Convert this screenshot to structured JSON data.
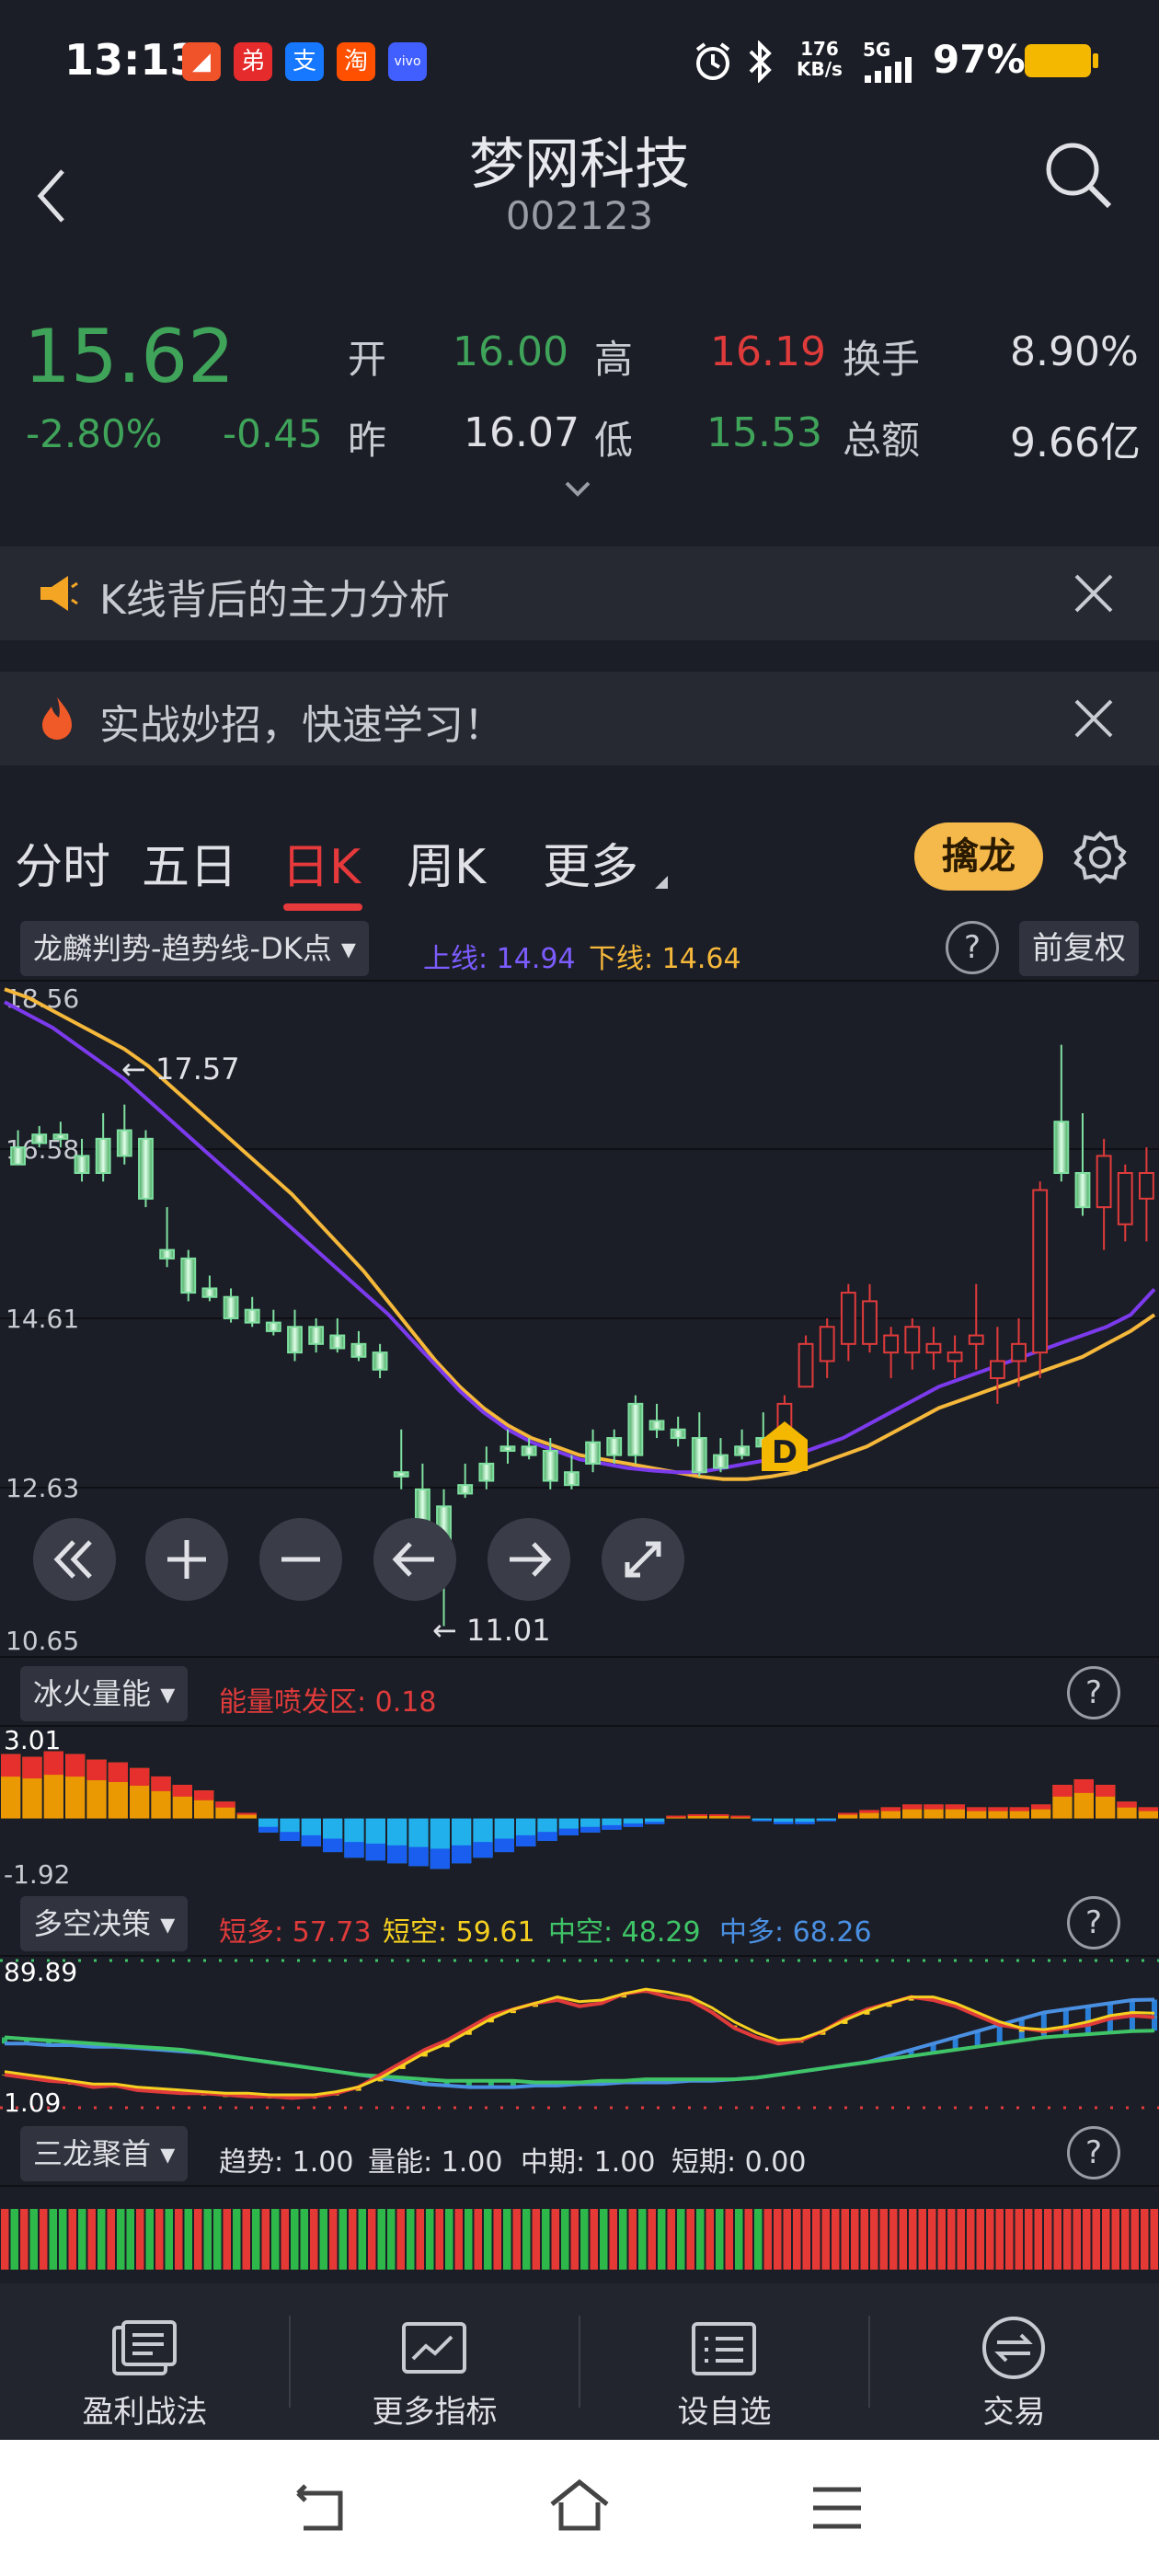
{
  "status_bar": {
    "time": "13:13",
    "net_speed_value": "176",
    "net_speed_unit": "KB/s",
    "network": "5G",
    "battery": "97%",
    "apps": [
      {
        "glyph": "◢",
        "color": "#f0522a"
      },
      {
        "glyph": "弟",
        "color": "#e52b2b"
      },
      {
        "glyph": "支",
        "color": "#1677ff"
      },
      {
        "glyph": "淘",
        "color": "#ff5000"
      },
      {
        "glyph": "vivo",
        "color": "#415fff"
      }
    ]
  },
  "header": {
    "name": "梦网科技",
    "code": "002123"
  },
  "quote": {
    "price": "15.62",
    "change_pct": "-2.80%",
    "change": "-0.45",
    "open_label": "开",
    "open": "16.00",
    "high_label": "高",
    "high": "16.19",
    "turnover_label": "换手",
    "turnover": "8.90%",
    "prev_label": "昨",
    "prev": "16.07",
    "low_label": "低",
    "low": "15.53",
    "amount_label": "总额",
    "amount": "9.66亿"
  },
  "banners": [
    {
      "text": "K线背后的主力分析"
    },
    {
      "text": "实战妙招，快速学习！"
    }
  ],
  "tabs": [
    {
      "label": "分时"
    },
    {
      "label": "五日"
    },
    {
      "label": "日K"
    },
    {
      "label": "周K"
    },
    {
      "label": "更多"
    }
  ],
  "tab_active": "日K",
  "qinlong_button": "擒龙",
  "main_chart": {
    "indicator": "龙麟判势-趋势线-DK点",
    "upper_label": "上线: 14.94",
    "lower_label": "下线: 14.64",
    "adjust": "前复权",
    "axis": [
      "18.56",
      "16.58",
      "14.61",
      "12.63",
      "10.65"
    ],
    "max_label": "17.57",
    "min_label": "11.01",
    "dk_marker": "D"
  },
  "colors": {
    "up": "#e03b3b",
    "down": "#3fa45a",
    "upper_line": "#7c3aed",
    "lower_line": "#f5b83a"
  },
  "chart_data": [
    {
      "type": "candlestick",
      "title": "",
      "ylim": [
        10.65,
        18.56
      ],
      "candles": [
        [
          16.6,
          16.8,
          16.4,
          16.4
        ],
        [
          16.75,
          16.85,
          16.6,
          16.65
        ],
        [
          16.75,
          16.9,
          16.6,
          16.7
        ],
        [
          16.5,
          16.7,
          16.2,
          16.3
        ],
        [
          16.7,
          17.0,
          16.2,
          16.3
        ],
        [
          16.8,
          17.1,
          16.4,
          16.5
        ],
        [
          16.7,
          16.8,
          15.9,
          16.0
        ],
        [
          15.4,
          15.9,
          15.2,
          15.3
        ],
        [
          15.3,
          15.4,
          14.8,
          14.9
        ],
        [
          14.95,
          15.1,
          14.8,
          14.85
        ],
        [
          14.85,
          14.95,
          14.55,
          14.6
        ],
        [
          14.7,
          14.85,
          14.5,
          14.55
        ],
        [
          14.55,
          14.7,
          14.4,
          14.45
        ],
        [
          14.5,
          14.7,
          14.1,
          14.2
        ],
        [
          14.5,
          14.6,
          14.2,
          14.3
        ],
        [
          14.4,
          14.6,
          14.2,
          14.25
        ],
        [
          14.3,
          14.45,
          14.1,
          14.15
        ],
        [
          14.2,
          14.3,
          13.9,
          14.0
        ],
        [
          12.8,
          13.3,
          12.6,
          12.75
        ],
        [
          12.6,
          12.9,
          11.8,
          12.2
        ],
        [
          12.4,
          12.6,
          11.0,
          11.6
        ],
        [
          12.65,
          12.9,
          12.5,
          12.55
        ],
        [
          12.9,
          13.1,
          12.6,
          12.7
        ],
        [
          13.1,
          13.3,
          12.9,
          13.05
        ],
        [
          13.1,
          13.2,
          12.95,
          13.0
        ],
        [
          13.05,
          13.2,
          12.6,
          12.7
        ],
        [
          12.8,
          13.0,
          12.6,
          12.65
        ],
        [
          13.15,
          13.3,
          12.8,
          12.9
        ],
        [
          13.2,
          13.3,
          12.9,
          13.0
        ],
        [
          13.6,
          13.7,
          12.9,
          13.0
        ],
        [
          13.4,
          13.6,
          13.2,
          13.3
        ],
        [
          13.3,
          13.45,
          13.1,
          13.2
        ],
        [
          13.2,
          13.5,
          12.75,
          12.8
        ],
        [
          13.0,
          13.2,
          12.8,
          12.85
        ],
        [
          13.1,
          13.3,
          12.95,
          13.0
        ],
        [
          13.2,
          13.5,
          12.9,
          13.1
        ],
        [
          13.3,
          13.7,
          13.2,
          13.6
        ],
        [
          13.8,
          14.4,
          13.8,
          14.3
        ],
        [
          14.1,
          14.6,
          13.9,
          14.5
        ],
        [
          14.3,
          15.0,
          14.1,
          14.9
        ],
        [
          14.3,
          15.0,
          14.2,
          14.8
        ],
        [
          14.2,
          14.5,
          13.9,
          14.4
        ],
        [
          14.2,
          14.6,
          14.0,
          14.5
        ],
        [
          14.2,
          14.5,
          14.0,
          14.3
        ],
        [
          14.1,
          14.4,
          13.9,
          14.2
        ],
        [
          14.3,
          15.0,
          14.0,
          14.4
        ],
        [
          13.9,
          14.5,
          13.6,
          14.1
        ],
        [
          14.1,
          14.6,
          13.8,
          14.3
        ],
        [
          14.2,
          16.2,
          13.9,
          16.1
        ],
        [
          16.9,
          17.8,
          16.2,
          16.3
        ],
        [
          16.3,
          17.0,
          15.8,
          15.9
        ],
        [
          15.9,
          16.7,
          15.4,
          16.5
        ],
        [
          15.7,
          16.4,
          15.5,
          16.3
        ],
        [
          16.0,
          16.6,
          15.5,
          16.3
        ]
      ],
      "upper_line": [
        18.3,
        18.15,
        18.0,
        17.8,
        17.6,
        17.4,
        17.15,
        16.9,
        16.65,
        16.4,
        16.15,
        15.9,
        15.65,
        15.4,
        15.15,
        14.9,
        14.65,
        14.35,
        14.05,
        13.75,
        13.5,
        13.3,
        13.15,
        13.05,
        12.95,
        12.9,
        12.85,
        12.82,
        12.8,
        12.8,
        12.85,
        12.9,
        12.95,
        13.0,
        13.1,
        13.2,
        13.35,
        13.5,
        13.65,
        13.8,
        13.9,
        14.0,
        14.1,
        14.2,
        14.3,
        14.4,
        14.5,
        14.64,
        14.94
      ],
      "lower_line": [
        18.45,
        18.35,
        18.2,
        18.05,
        17.9,
        17.75,
        17.55,
        17.3,
        17.05,
        16.8,
        16.55,
        16.3,
        16.05,
        15.75,
        15.45,
        15.15,
        14.8,
        14.45,
        14.1,
        13.8,
        13.55,
        13.35,
        13.2,
        13.1,
        13.0,
        12.95,
        12.9,
        12.85,
        12.8,
        12.75,
        12.72,
        12.72,
        12.75,
        12.8,
        12.9,
        13.0,
        13.1,
        13.25,
        13.4,
        13.55,
        13.65,
        13.75,
        13.85,
        13.95,
        14.05,
        14.15,
        14.3,
        14.45,
        14.64
      ]
    },
    {
      "type": "bar",
      "title": "冰火量能",
      "ylim": [
        -1.92,
        3.01
      ],
      "values": [
        2.3,
        2.2,
        2.4,
        2.3,
        2.1,
        2.0,
        1.8,
        1.5,
        1.2,
        1.0,
        0.6,
        0.2,
        -0.5,
        -0.8,
        -1.0,
        -1.2,
        -1.4,
        -1.5,
        -1.6,
        -1.7,
        -1.8,
        -1.6,
        -1.4,
        -1.2,
        -1.0,
        -0.8,
        -0.6,
        -0.5,
        -0.4,
        -0.3,
        -0.2,
        0.1,
        0.15,
        0.15,
        0.1,
        -0.1,
        -0.2,
        -0.2,
        -0.1,
        0.2,
        0.3,
        0.4,
        0.5,
        0.5,
        0.5,
        0.4,
        0.4,
        0.4,
        0.5,
        1.2,
        1.4,
        1.2,
        0.6,
        0.4
      ]
    },
    {
      "type": "line",
      "title": "多空决策",
      "ylim": [
        1.09,
        89.89
      ],
      "series": [
        {
          "name": "短多",
          "values": [
            20,
            18,
            16,
            15,
            12,
            13,
            10,
            9,
            8,
            8,
            7,
            6,
            6,
            5,
            6,
            8,
            12,
            20,
            28,
            36,
            42,
            50,
            58,
            62,
            66,
            68,
            64,
            66,
            72,
            74,
            70,
            68,
            60,
            50,
            44,
            40,
            42,
            48,
            56,
            62,
            66,
            70,
            68,
            64,
            58,
            52,
            50,
            48,
            50,
            52,
            56,
            58,
            57
          ]
        },
        {
          "name": "短空",
          "values": [
            22,
            20,
            18,
            16,
            14,
            14,
            12,
            11,
            10,
            9,
            8,
            8,
            7,
            7,
            7,
            9,
            12,
            18,
            26,
            34,
            40,
            48,
            56,
            62,
            66,
            70,
            67,
            68,
            72,
            75,
            73,
            70,
            63,
            54,
            47,
            42,
            43,
            48,
            55,
            61,
            66,
            70,
            70,
            66,
            60,
            54,
            50,
            49,
            51,
            54,
            58,
            60,
            59.6
          ]
        },
        {
          "name": "中空",
          "values": [
            44,
            43,
            42,
            41,
            40,
            39,
            38,
            37,
            36,
            34,
            32,
            30,
            28,
            26,
            24,
            22,
            20,
            19,
            18,
            17,
            16,
            16,
            16,
            16,
            15,
            15,
            15,
            16,
            16,
            17,
            17,
            17,
            17,
            17,
            18,
            20,
            22,
            24,
            26,
            28,
            30,
            32,
            34,
            36,
            38,
            40,
            42,
            44,
            45,
            46,
            47,
            48,
            48.3
          ]
        },
        {
          "name": "中多",
          "values": [
            40,
            40,
            39,
            39,
            38,
            38,
            37,
            36,
            35,
            34,
            32,
            30,
            28,
            26,
            24,
            22,
            20,
            18,
            16,
            14,
            13,
            12,
            12,
            12,
            13,
            13,
            14,
            14,
            15,
            15,
            15,
            16,
            16,
            17,
            18,
            20,
            22,
            24,
            26,
            28,
            32,
            36,
            40,
            44,
            48,
            52,
            56,
            60,
            62,
            64,
            66,
            68,
            68.3
          ]
        }
      ]
    },
    {
      "type": "heatmap",
      "title": "三龙聚首",
      "values": [
        "r",
        "g",
        "r",
        "g",
        "r",
        "g",
        "g",
        "r",
        "g",
        "r",
        "g",
        "r",
        "g",
        "g",
        "r",
        "g",
        "r",
        "g",
        "r",
        "g",
        "r",
        "g",
        "g",
        "r",
        "g",
        "r",
        "g",
        "r",
        "g",
        "r",
        "g",
        "g",
        "r",
        "g",
        "r",
        "g",
        "r",
        "g",
        "r",
        "g",
        "g",
        "r",
        "g",
        "r",
        "g",
        "r",
        "g",
        "r",
        "g",
        "r",
        "g",
        "r",
        "g",
        "r",
        "g",
        "r",
        "g",
        "r",
        "g",
        "r",
        "g",
        "r",
        "g",
        "r",
        "g",
        "r",
        "g",
        "r",
        "g",
        "r",
        "g",
        "r",
        "g",
        "r",
        "g",
        "r",
        "g",
        "r",
        "g",
        "r",
        "r",
        "r",
        "r",
        "r",
        "r",
        "r",
        "r",
        "r",
        "r",
        "r",
        "r",
        "r",
        "r",
        "r",
        "r",
        "r",
        "r",
        "r",
        "r",
        "r",
        "r",
        "r",
        "r",
        "r",
        "r",
        "r",
        "r",
        "r",
        "r",
        "r",
        "r",
        "r",
        "r",
        "r",
        "r",
        "r",
        "r",
        "r",
        "r",
        "r"
      ]
    }
  ],
  "vol_panel": {
    "indicator": "冰火量能",
    "label": "能量喷发区: 0.18",
    "axis_top": "3.01",
    "axis_bottom": "-1.92"
  },
  "ls_panel": {
    "indicator": "多空决策",
    "short_long": "短多: 57.73",
    "short_short": "短空: 59.61",
    "mid_short": "中空: 48.29",
    "mid_long": "中多: 68.26",
    "axis_top": "89.89",
    "axis_bottom": "1.09"
  },
  "tl_panel": {
    "indicator": "三龙聚首",
    "trend": "趋势: 1.00",
    "energy": "量能: 1.00",
    "mid": "中期: 1.00",
    "short": "短期: 0.00"
  },
  "bottom_nav": [
    {
      "label": "盈利战法"
    },
    {
      "label": "更多指标"
    },
    {
      "label": "设自选"
    },
    {
      "label": "交易"
    }
  ]
}
